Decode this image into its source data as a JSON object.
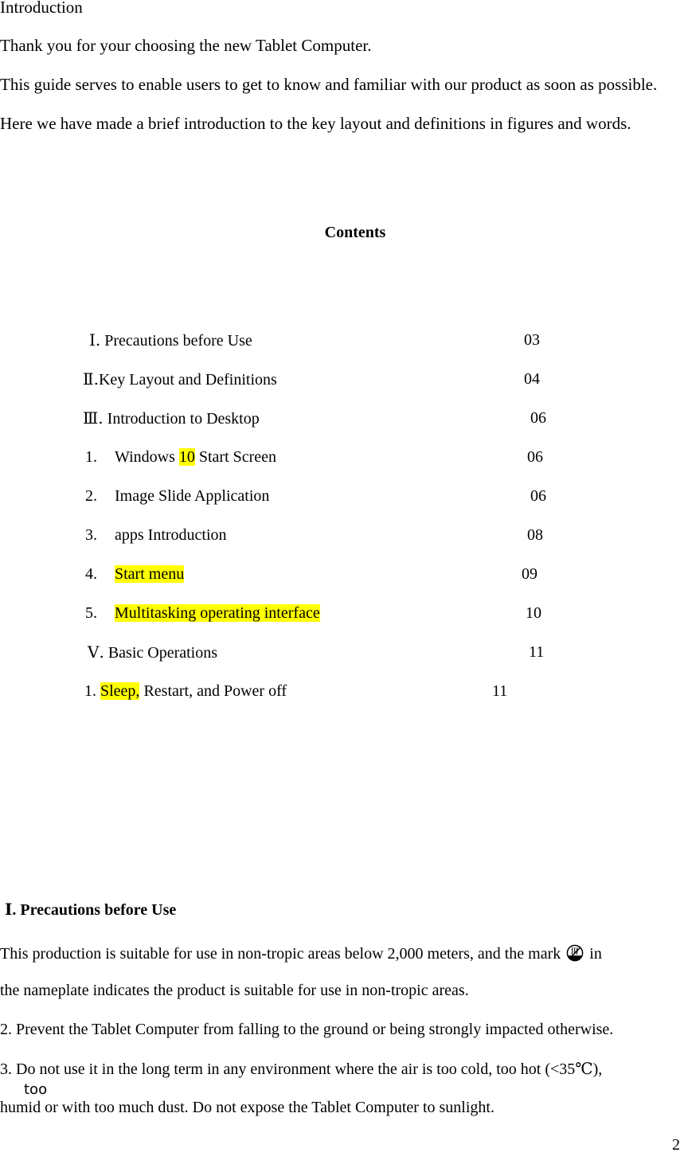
{
  "intro": {
    "heading": "Introduction",
    "lines": [
      "Thank you for your choosing the new Tablet Computer.",
      "This guide serves to enable users to get to know and familiar with our product as soon as possible.",
      "Here we have made a brief introduction to the key layout and definitions in figures and words."
    ]
  },
  "contents": {
    "title": "Contents",
    "entries": [
      {
        "prefix": "Ⅰ.",
        "text": "Precautions before Use",
        "page": "03"
      },
      {
        "prefix": "Ⅱ.",
        "text": "Key Layout and Definitions",
        "page": "04"
      },
      {
        "prefix": "Ⅲ.",
        "text": "Introduction to Desktop",
        "page": "06"
      },
      {
        "prefix": "1.",
        "text_before": "Windows ",
        "highlight": "10",
        "text_after": " Start Screen",
        "page": "06"
      },
      {
        "prefix": "2.",
        "text": "Image Slide Application",
        "page": "06"
      },
      {
        "prefix": "3.",
        "text": "apps Introduction",
        "page": "08"
      },
      {
        "prefix": "4.",
        "highlight": "Start menu",
        "page": "09"
      },
      {
        "prefix": "5.",
        "highlight": "Multitasking operating interface",
        "page": "10"
      },
      {
        "prefix": "Ⅴ.",
        "text": "Basic Operations",
        "page": "11"
      },
      {
        "prefix": "1.",
        "highlight": "Sleep,",
        "text_after": " Restart, and Power off",
        "page": "11"
      }
    ]
  },
  "precautions": {
    "heading": "Ⅰ. Precautions before Use",
    "line1a_before": "This production is suitable for use in non-tropic areas below 2,000 meters, and the mark",
    "line1a_after": "in",
    "mark_icon": "non-tropic-mark-icon",
    "line1b": "the nameplate indicates the product is suitable for use in non-tropic areas.",
    "line2": "2. Prevent the Tablet Computer from falling to the ground or being strongly impacted otherwise.",
    "line3a": "3. Do not use it in the long term in any environment where the air is too cold, too hot (<35℃),",
    "line3b": "too",
    "line3c": "humid or with too much dust. Do not expose the Tablet Computer to sunlight."
  },
  "footer": {
    "page_number": "2"
  },
  "colors": {
    "highlight": "#ffff00",
    "text": "#000000",
    "background": "#ffffff"
  }
}
